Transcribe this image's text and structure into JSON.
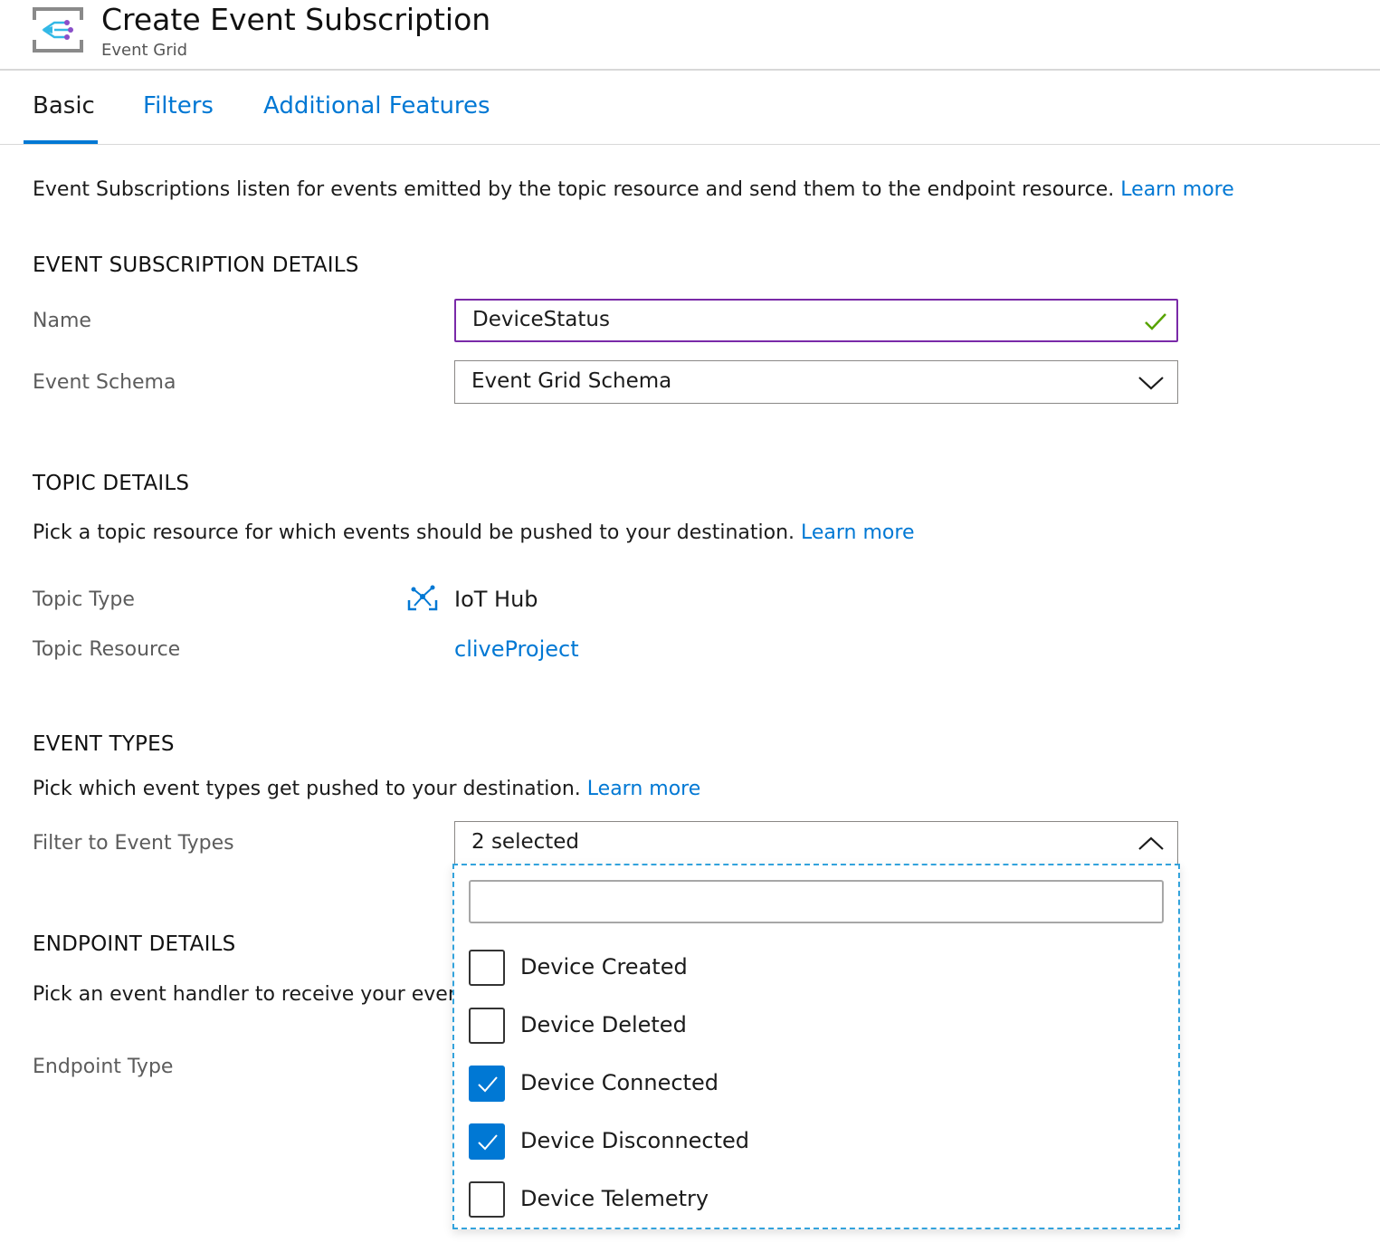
{
  "header": {
    "title": "Create Event Subscription",
    "subtitle": "Event Grid",
    "icon": "event-grid-icon"
  },
  "tabs": [
    {
      "label": "Basic",
      "active": true
    },
    {
      "label": "Filters",
      "active": false
    },
    {
      "label": "Additional Features",
      "active": false
    }
  ],
  "intro": {
    "text": "Event Subscriptions listen for events emitted by the topic resource and send them to the endpoint resource.",
    "link": "Learn more"
  },
  "event_subscription_details": {
    "title": "EVENT SUBSCRIPTION DETAILS",
    "name_label": "Name",
    "name_value": "DeviceStatus",
    "schema_label": "Event Schema",
    "schema_value": "Event Grid Schema"
  },
  "topic_details": {
    "title": "TOPIC DETAILS",
    "description": "Pick a topic resource for which events should be pushed to your destination.",
    "link": "Learn more",
    "type_label": "Topic Type",
    "type_value": "IoT Hub",
    "type_icon": "iot-hub-icon",
    "resource_label": "Topic Resource",
    "resource_value": "cliveProject"
  },
  "event_types": {
    "title": "EVENT TYPES",
    "description": "Pick which event types get pushed to your destination.",
    "link": "Learn more",
    "filter_label": "Filter to Event Types",
    "filter_value": "2 selected",
    "search_placeholder": "",
    "options": [
      {
        "label": "Device Created",
        "checked": false
      },
      {
        "label": "Device Deleted",
        "checked": false
      },
      {
        "label": "Device Connected",
        "checked": true
      },
      {
        "label": "Device Disconnected",
        "checked": true
      },
      {
        "label": "Device Telemetry",
        "checked": false
      }
    ]
  },
  "endpoint_details": {
    "title": "ENDPOINT DETAILS",
    "description": "Pick an event handler to receive your events",
    "type_label": "Endpoint Type"
  },
  "colors": {
    "accent": "#0078d4",
    "focus_border": "#7a2aa8",
    "valid_check": "#57a300",
    "dropdown_border": "#33a3dc"
  }
}
